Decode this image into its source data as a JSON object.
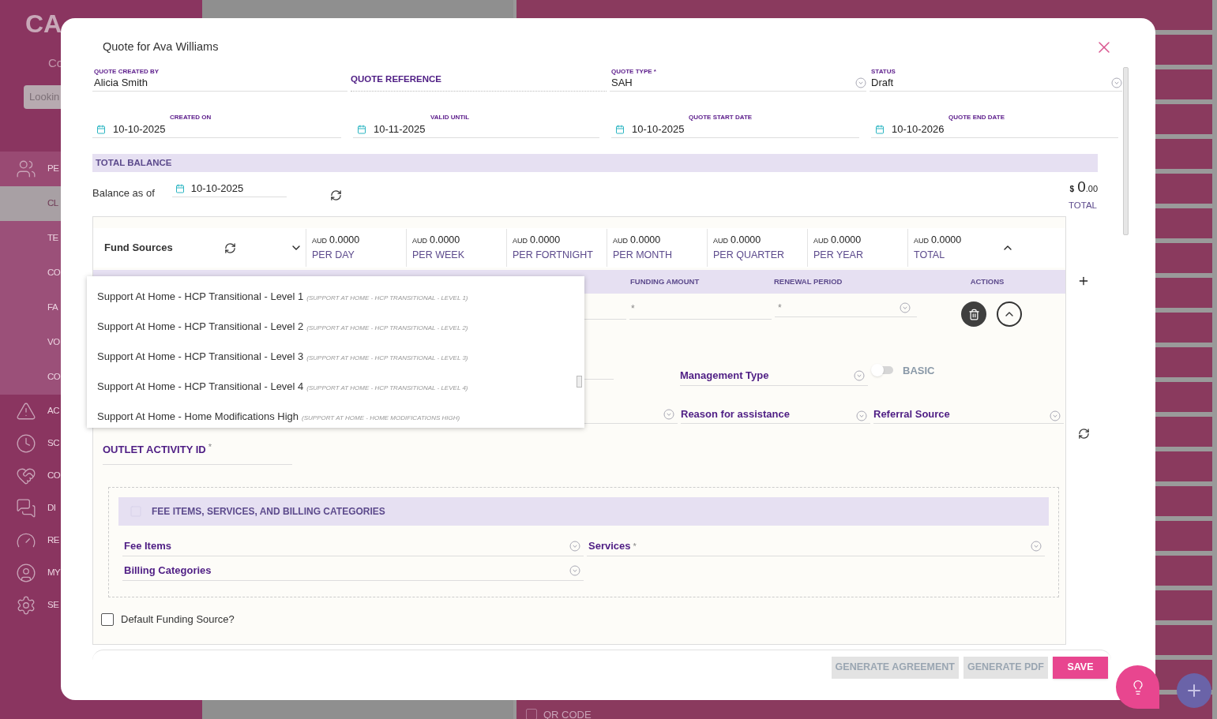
{
  "sidebar": {
    "logo": "CA",
    "subtitle": "Co",
    "search_placeholder": "Lookin",
    "items": [
      {
        "label": "PE",
        "kind": "main",
        "selected": false
      },
      {
        "label": "CL",
        "kind": "sub",
        "selected": true
      },
      {
        "label": "TE",
        "kind": "sub",
        "selected": false
      },
      {
        "label": "CO",
        "kind": "sub",
        "selected": false
      },
      {
        "label": "FA",
        "kind": "sub",
        "selected": false
      },
      {
        "label": "VO",
        "kind": "sub",
        "selected": false
      },
      {
        "label": "CO",
        "kind": "sub",
        "selected": false
      },
      {
        "label": "AC",
        "kind": "main",
        "selected": false
      },
      {
        "label": "SC",
        "kind": "main",
        "selected": false
      },
      {
        "label": "CO",
        "kind": "main",
        "selected": false
      },
      {
        "label": "DI",
        "kind": "main",
        "selected": false
      },
      {
        "label": "RE",
        "kind": "main",
        "selected": false
      },
      {
        "label": "MY",
        "kind": "main",
        "selected": false
      },
      {
        "label": "SE",
        "kind": "main",
        "selected": false
      }
    ]
  },
  "right_panel": {
    "qr_code": "QR CODE"
  },
  "modal": {
    "title": "Quote for Ava Williams",
    "fields": [
      {
        "label": "QUOTE CREATED BY",
        "value": "Alicia Smith",
        "kind": "text"
      },
      {
        "label": "QUOTE REFERENCE",
        "kind": "reference"
      },
      {
        "label": "QUOTE TYPE *",
        "value": "SAH",
        "kind": "select"
      },
      {
        "label": "STATUS",
        "value": "Draft",
        "kind": "select"
      }
    ],
    "dates": [
      {
        "label": "CREATED ON",
        "value": "10-10-2025"
      },
      {
        "label": "VALID UNTIL",
        "value": "10-11-2025"
      },
      {
        "label": "QUOTE START DATE",
        "value": "10-10-2025"
      },
      {
        "label": "QUOTE END DATE",
        "value": "10-10-2026"
      }
    ],
    "total_balance": {
      "heading": "TOTAL BALANCE",
      "balance_label": "Balance as of",
      "balance_date": "10-10-2025",
      "currency": "$",
      "amount": "0",
      "cents": ".00",
      "total_label": "TOTAL"
    },
    "fund_sources": {
      "title": "Fund Sources",
      "summary": [
        {
          "currency": "AUD",
          "amount": "0.0000",
          "period": "PER DAY"
        },
        {
          "currency": "AUD",
          "amount": "0.0000",
          "period": "PER WEEK"
        },
        {
          "currency": "AUD",
          "amount": "0.0000",
          "period": "PER FORTNIGHT"
        },
        {
          "currency": "AUD",
          "amount": "0.0000",
          "period": "PER MONTH"
        },
        {
          "currency": "AUD",
          "amount": "0.0000",
          "period": "PER QUARTER"
        },
        {
          "currency": "AUD",
          "amount": "0.0000",
          "period": "PER YEAR"
        },
        {
          "currency": "AUD",
          "amount": "0.0000",
          "period": "TOTAL"
        }
      ],
      "headers": [
        "FUNDING AMOUNT",
        "RENEWAL PERIOD",
        "ACTIONS"
      ],
      "funding_amount": {
        "placeholder": "*"
      },
      "renewal_period": {
        "placeholder": "*"
      },
      "management_type": "Management Type",
      "toggle": {
        "label": "BASIC",
        "on": false
      },
      "selects": [
        "Reason for assistance",
        "Referral Source"
      ],
      "outlet": {
        "label": "OUTLET ACTIVITY ID",
        "required": true
      },
      "fee_section": {
        "heading": "FEE ITEMS, SERVICES, AND BILLING CATEGORIES",
        "fields": [
          {
            "label": "Fee Items",
            "required": false
          },
          {
            "label": "Services",
            "required": true
          },
          {
            "label": "Billing Categories",
            "required": false
          }
        ]
      },
      "default_checkbox": {
        "label": "Default Funding Source?",
        "checked": false
      }
    },
    "dropdown": [
      {
        "name": "Support At Home - HCP Transitional - Level 1",
        "code": "(SUPPORT AT HOME - HCP TRANSITIONAL - LEVEL 1)"
      },
      {
        "name": "Support At Home - HCP Transitional - Level 2",
        "code": "(SUPPORT AT HOME - HCP TRANSITIONAL - LEVEL 2)"
      },
      {
        "name": "Support At Home - HCP Transitional - Level 3",
        "code": "(SUPPORT AT HOME - HCP TRANSITIONAL - LEVEL 3)"
      },
      {
        "name": "Support At Home - HCP Transitional - Level 4",
        "code": "(SUPPORT AT HOME - HCP TRANSITIONAL - LEVEL 4)"
      },
      {
        "name": "Support At Home - Home Modifications High",
        "code": "(SUPPORT AT HOME - HOME MODIFICATIONS HIGH)"
      }
    ],
    "footer_buttons": [
      {
        "label": "GENERATE AGREEMENT",
        "disabled": true
      },
      {
        "label": "GENERATE PDF",
        "disabled": true
      },
      {
        "label": "SAVE",
        "disabled": false
      }
    ]
  }
}
